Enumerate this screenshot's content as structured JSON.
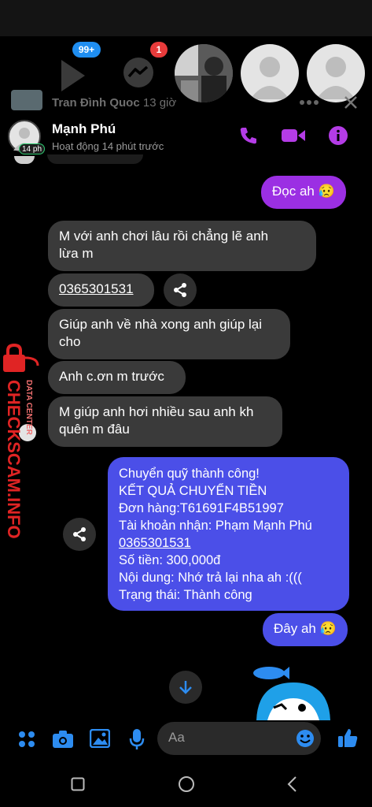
{
  "chat_heads": {
    "badge_play": "99+",
    "badge_messenger": "1"
  },
  "previous_chat": {
    "name": "Tran Đình Quoc",
    "time": "13 giờ"
  },
  "header": {
    "name": "Mạnh Phú",
    "status": "Hoạt động 14 phút trước",
    "avatar_badge": "14 ph"
  },
  "messages": {
    "m1": "Đọc ah 😥",
    "m2_line1": "M với anh chơi lâu rồi chẳng lẽ anh",
    "m2_line2": "lừa m",
    "m3": "0365301531",
    "m4_line1": "Giúp anh về nhà xong anh giúp lại",
    "m4_line2": "cho",
    "m5": "Anh c.ơn m trước",
    "m6_line1": "M giúp anh hơi nhiều sau anh kh",
    "m6_line2": "quên m đâu",
    "transfer": {
      "line1": "Chuyển quỹ thành công!",
      "line2": "KẾT QUẢ CHUYỂN TIỀN",
      "line3": "Đơn hàng:T61691F4B51997",
      "line4": "Tài khoản nhận:  Phạm Mạnh Phú",
      "line5": "0365301531",
      "line6": "Số tiền:  300,000đ",
      "line7": "Nội dung:  Nhớ trả lại nha ah :(((",
      "line8": "Trạng thái:  Thành công"
    },
    "m8": "Đây ah 😥"
  },
  "composer": {
    "placeholder": "Aa"
  },
  "watermark": {
    "main": "CHECKSCAM.INFO",
    "sub": "DATA CENTER"
  },
  "colors": {
    "accent_purple": "#b43ce6",
    "bubble_purple": "#9b2fe3",
    "bubble_blue": "#4b4fe8",
    "composer_blue": "#2d8cf0",
    "watermark_red": "#e02424"
  }
}
